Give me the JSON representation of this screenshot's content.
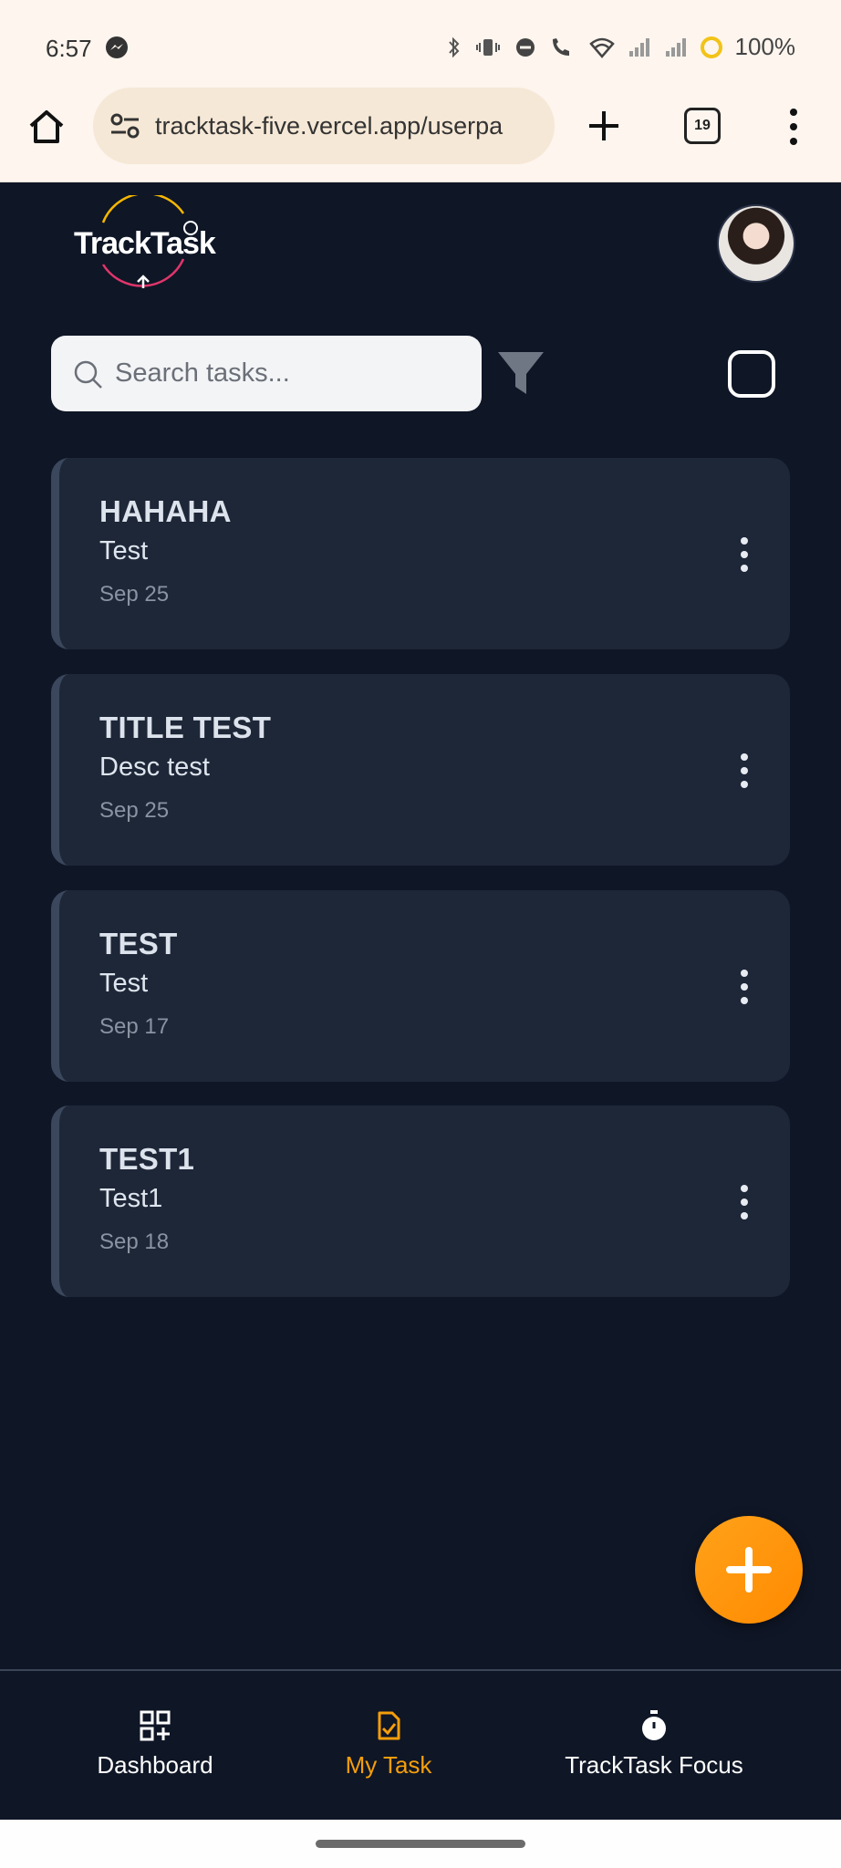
{
  "status_bar": {
    "time": "6:57",
    "battery": "100%",
    "battery_ring_color": "#f2c318"
  },
  "browser": {
    "url": "tracktask-five.vercel.app/userpa",
    "tab_count": "19"
  },
  "app": {
    "logo_text": "TrackTask",
    "search": {
      "placeholder": "Search tasks...",
      "value": ""
    }
  },
  "tasks": [
    {
      "title": "HAHAHA",
      "description": "Test",
      "date": "Sep 25"
    },
    {
      "title": "TITLE TEST",
      "description": "Desc test",
      "date": "Sep 25"
    },
    {
      "title": "TEST",
      "description": "Test",
      "date": "Sep 17"
    },
    {
      "title": "TEST1",
      "description": "Test1",
      "date": "Sep 18"
    }
  ],
  "bottom_nav": {
    "items": [
      {
        "label": "Dashboard",
        "icon": "dashboard-icon",
        "active": false
      },
      {
        "label": "My Task",
        "icon": "task-check-icon",
        "active": true
      },
      {
        "label": "TrackTask Focus",
        "icon": "stopwatch-icon",
        "active": false
      }
    ]
  },
  "colors": {
    "background": "#0f1626",
    "card": "#1d2738",
    "accent": "#f59e0b",
    "fab": "#ff9500"
  }
}
